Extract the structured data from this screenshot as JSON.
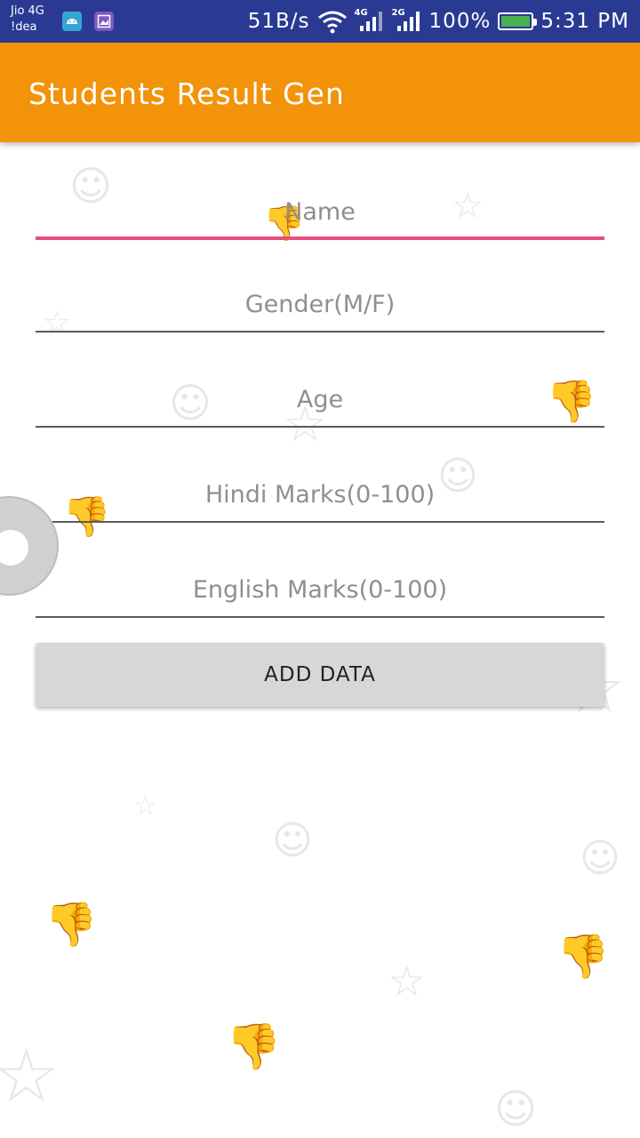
{
  "status_bar": {
    "carrier_line1": "Jio 4G",
    "carrier_line2": "!dea",
    "speed": "51B/s",
    "network1": "4G",
    "network2": "2G",
    "battery": "100%",
    "time": "5:31 PM",
    "battery_color": "#4caf50",
    "icons": [
      "android-icon",
      "gallery-icon",
      "wifi-icon",
      "signal-icon",
      "signal-icon",
      "battery-icon"
    ]
  },
  "app_bar": {
    "title": "Students Result Gen",
    "color": "#f2930a"
  },
  "form": {
    "name_placeholder": "Name",
    "gender_placeholder": "Gender(M/F)",
    "age_placeholder": "Age",
    "hindi_placeholder": "Hindi Marks(0-100)",
    "english_placeholder": "English Marks(0-100)",
    "active_underline_color": "#e94f7c"
  },
  "add_button": {
    "label": "ADD DATA"
  }
}
